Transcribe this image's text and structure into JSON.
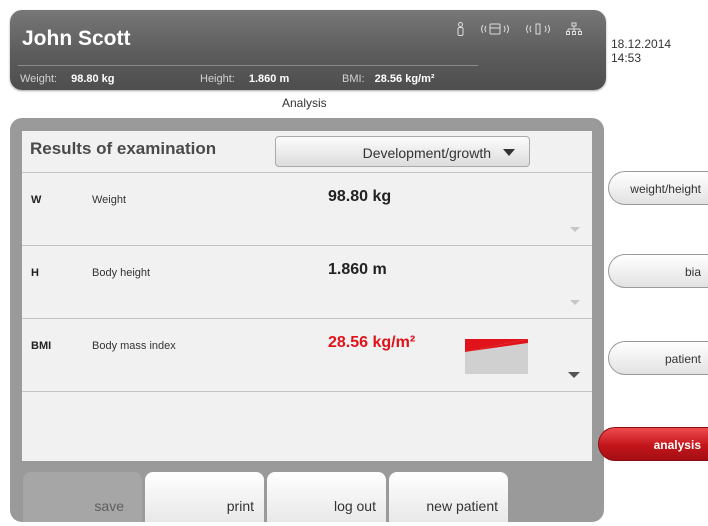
{
  "header": {
    "patient_name": "John Scott",
    "metrics": [
      {
        "label": "Weight:",
        "value": "98.80 kg"
      },
      {
        "label": "Height:",
        "value": "1.860 m"
      },
      {
        "label": "BMI:",
        "value": "28.56 kg/m²"
      }
    ],
    "status_icons": [
      "person-icon",
      "scale-icon",
      "wireless-icon",
      "network-icon"
    ],
    "date": "18.12.2014",
    "time": "14:53"
  },
  "section_title": "Analysis",
  "results": {
    "title": "Results of examination",
    "dropdown_value": "Development/growth",
    "rows": [
      {
        "abbr": "W",
        "name": "Weight",
        "value": "98.80 kg"
      },
      {
        "abbr": "H",
        "name": "Body height",
        "value": "1.860 m"
      },
      {
        "abbr": "BMI",
        "name": "Body mass index",
        "value": "28.56 kg/m²"
      }
    ]
  },
  "bottom_buttons": {
    "save": "save",
    "print": "print",
    "logout": "log out",
    "new_patient": "new patient"
  },
  "side_nav": {
    "weight_height": "weight/height",
    "bia": "bia",
    "patient": "patient",
    "analysis": "analysis"
  },
  "colors": {
    "accent_red": "#e0121a",
    "active_nav": "#c3161b",
    "header_bg": "#5c5c5c"
  }
}
